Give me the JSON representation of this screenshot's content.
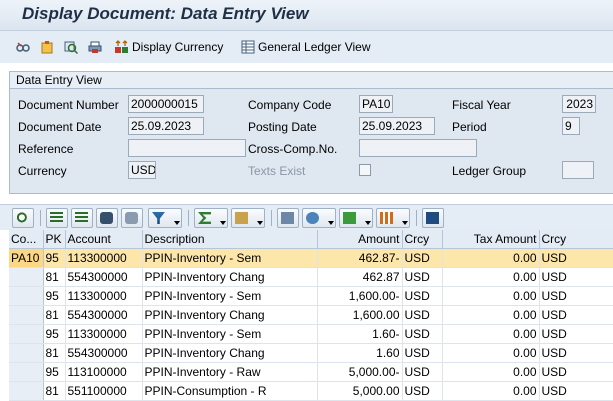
{
  "window": {
    "title": "Display Document: Data Entry View"
  },
  "toolbar": {
    "display_currency_label": "Display Currency",
    "general_ledger_view_label": "General Ledger View",
    "icons": [
      "glasses-icon",
      "clipboard-icon",
      "display-icon",
      "print-icon",
      "currency-icon",
      "ledger-icon"
    ]
  },
  "header_panel": {
    "title": "Data Entry View",
    "document_number_label": "Document Number",
    "document_number": "2000000015",
    "company_code_label": "Company Code",
    "company_code": "PA10",
    "fiscal_year_label": "Fiscal Year",
    "fiscal_year": "2023",
    "document_date_label": "Document Date",
    "document_date": "25.09.2023",
    "posting_date_label": "Posting Date",
    "posting_date": "25.09.2023",
    "period_label": "Period",
    "period": "9",
    "reference_label": "Reference",
    "reference": "",
    "cross_comp_label": "Cross-Comp.No.",
    "cross_comp": "",
    "currency_label": "Currency",
    "currency": "USD",
    "texts_exist_label": "Texts Exist",
    "ledger_group_label": "Ledger Group",
    "ledger_group": ""
  },
  "grid": {
    "columns": [
      "Co...",
      "PK",
      "Account",
      "Description",
      "Amount",
      "Crcy",
      "Tax Amount",
      "Crcy"
    ],
    "rows": [
      {
        "co": "PA10",
        "pk": "95",
        "account": "113300000",
        "description": "PPIN-Inventory - Sem",
        "amount": "462.87-",
        "crcy": "USD",
        "tax": "0.00",
        "tcrcy": "USD"
      },
      {
        "co": "",
        "pk": "81",
        "account": "554300000",
        "description": "PPIN-Inventory Chang",
        "amount": "462.87",
        "crcy": "USD",
        "tax": "0.00",
        "tcrcy": "USD"
      },
      {
        "co": "",
        "pk": "95",
        "account": "113300000",
        "description": "PPIN-Inventory - Sem",
        "amount": "1,600.00-",
        "crcy": "USD",
        "tax": "0.00",
        "tcrcy": "USD"
      },
      {
        "co": "",
        "pk": "81",
        "account": "554300000",
        "description": "PPIN-Inventory Chang",
        "amount": "1,600.00",
        "crcy": "USD",
        "tax": "0.00",
        "tcrcy": "USD"
      },
      {
        "co": "",
        "pk": "95",
        "account": "113300000",
        "description": "PPIN-Inventory - Sem",
        "amount": "1.60-",
        "crcy": "USD",
        "tax": "0.00",
        "tcrcy": "USD"
      },
      {
        "co": "",
        "pk": "81",
        "account": "554300000",
        "description": "PPIN-Inventory Chang",
        "amount": "1.60",
        "crcy": "USD",
        "tax": "0.00",
        "tcrcy": "USD"
      },
      {
        "co": "",
        "pk": "95",
        "account": "113100000",
        "description": "PPIN-Inventory - Raw",
        "amount": "5,000.00-",
        "crcy": "USD",
        "tax": "0.00",
        "tcrcy": "USD"
      },
      {
        "co": "",
        "pk": "81",
        "account": "551100000",
        "description": "PPIN-Consumption - R",
        "amount": "5,000.00",
        "crcy": "USD",
        "tax": "0.00",
        "tcrcy": "USD"
      }
    ]
  },
  "colors": {
    "selected_row": "#fde6a9",
    "title_text": "#1f2f46",
    "panel_bg": "#dfe8f1"
  }
}
